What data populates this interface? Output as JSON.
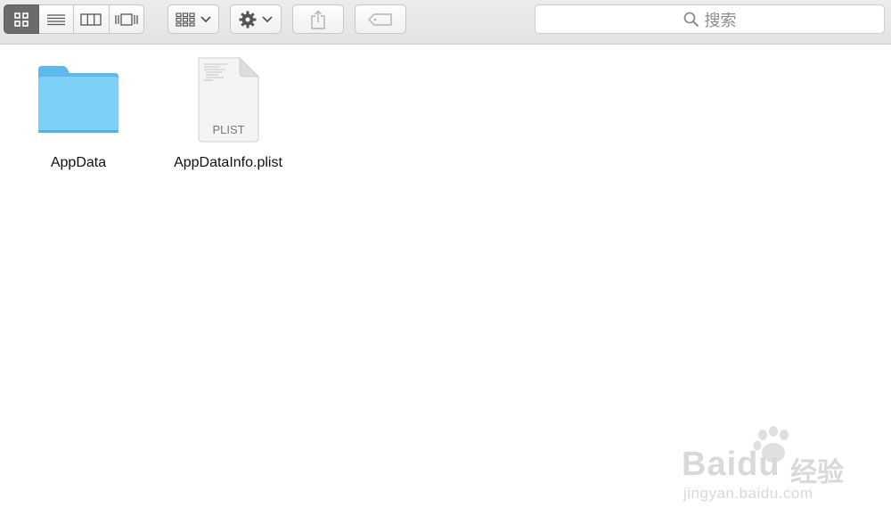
{
  "toolbar": {
    "view_modes": [
      "icon-view",
      "list-view",
      "column-view",
      "cover-flow-view"
    ],
    "active_view": "icon-view",
    "search": {
      "placeholder": "搜索"
    }
  },
  "files": [
    {
      "name": "AppData",
      "kind": "folder"
    },
    {
      "name": "AppDataInfo.plist",
      "kind": "document",
      "badge": "PLIST"
    }
  ],
  "watermark": {
    "brand": "Baidu",
    "suffix": "经验",
    "url": "jingyan.baidu.com"
  },
  "colors": {
    "folder": "#6cc7f5",
    "toolbar": "#e6e6e6",
    "active_segment": "#6b6b6b"
  }
}
